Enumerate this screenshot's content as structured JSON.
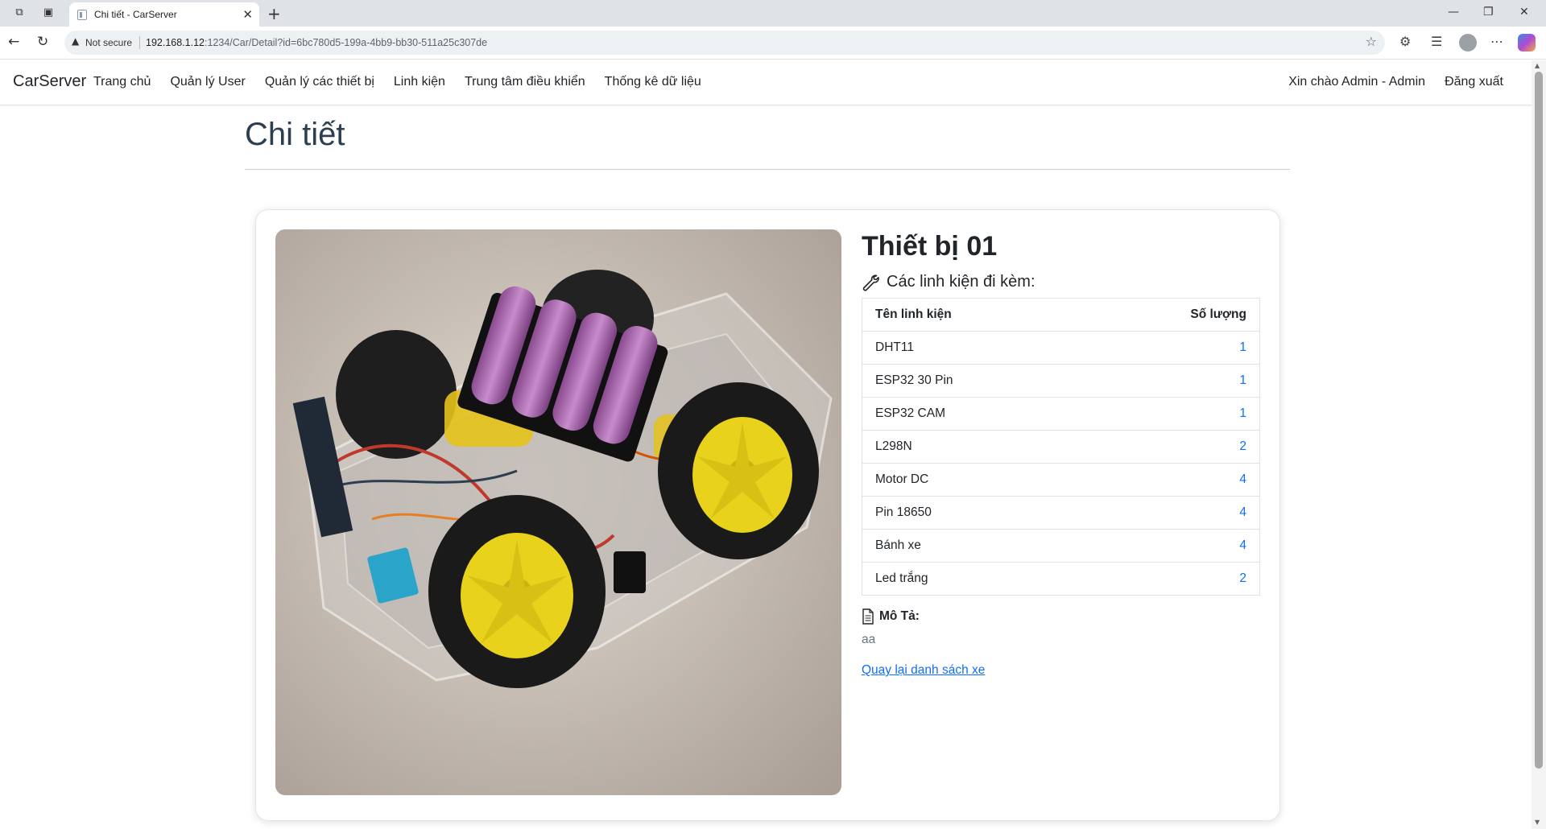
{
  "browser": {
    "tab_title": "Chi tiết - CarServer",
    "security_label": "Not secure",
    "url_host": "192.168.1.12",
    "url_path": ":1234/Car/Detail?id=6bc780d5-199a-4bb9-bb30-511a25c307de"
  },
  "nav": {
    "brand": "CarServer",
    "links": [
      "Trang chủ",
      "Quản lý User",
      "Quản lý các thiết bị",
      "Linh kiện",
      "Trung tâm điều khiển",
      "Thống kê dữ liệu"
    ],
    "greeting": "Xin chào Admin - Admin",
    "logout": "Đăng xuất"
  },
  "page": {
    "title": "Chi tiết"
  },
  "device": {
    "name": "Thiết bị 01",
    "components_heading": "Các linh kiện đi kèm:",
    "table_headers": {
      "name": "Tên linh kiện",
      "qty": "Số lượng"
    },
    "components": [
      {
        "name": "DHT11",
        "qty": "1"
      },
      {
        "name": "ESP32 30 Pin",
        "qty": "1"
      },
      {
        "name": "ESP32 CAM",
        "qty": "1"
      },
      {
        "name": "L298N",
        "qty": "2"
      },
      {
        "name": "Motor DC",
        "qty": "4"
      },
      {
        "name": "Pin 18650",
        "qty": "4"
      },
      {
        "name": "Bánh xe",
        "qty": "4"
      },
      {
        "name": "Led trắng",
        "qty": "2"
      }
    ],
    "description_label": "Mô Tả:",
    "description": "aa",
    "back_link": "Quay lại danh sách xe"
  },
  "icons": {
    "tool_icon": "wrench-icon",
    "desc_icon": "document-icon"
  },
  "colors": {
    "link": "#0d6efd",
    "title": "#2c3e50",
    "muted": "#6c757d"
  }
}
